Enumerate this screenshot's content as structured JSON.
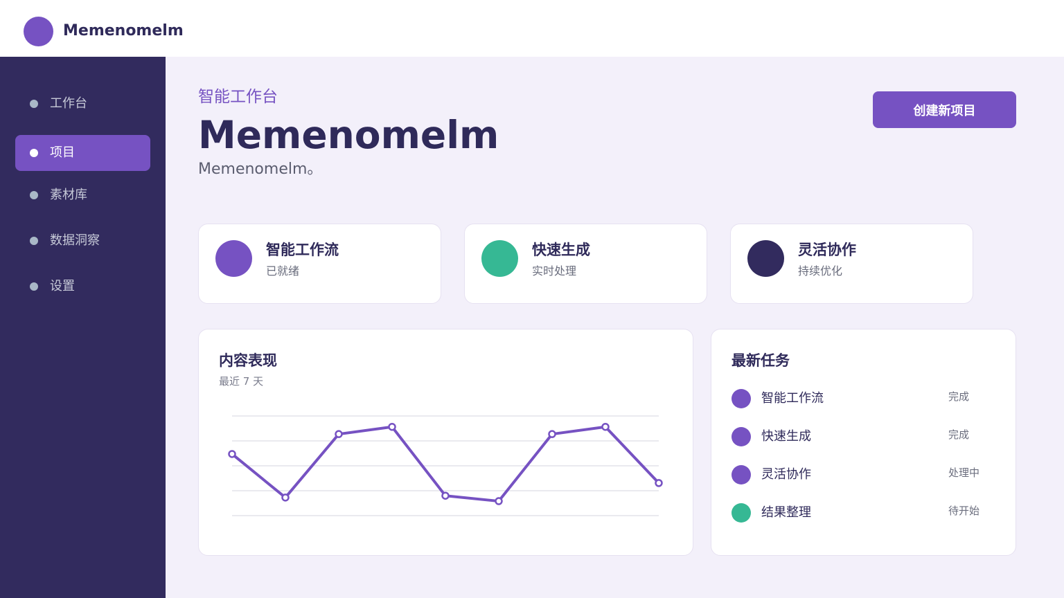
{
  "brand": {
    "name": "Memenomelm",
    "color": "#7652c2"
  },
  "sidebar": {
    "items": [
      {
        "label": "工作台",
        "active": false
      },
      {
        "label": "项目",
        "active": true
      },
      {
        "label": "素材库",
        "active": false
      },
      {
        "label": "数据洞察",
        "active": false
      },
      {
        "label": "设置",
        "active": false
      }
    ]
  },
  "header": {
    "eyebrow": "智能工作台",
    "title": "Memenomelm",
    "description": "Memenomelm。",
    "create_button": "创建新项目"
  },
  "features": [
    {
      "title": "智能工作流",
      "subtitle": "已就绪",
      "color": "#7652c2"
    },
    {
      "title": "快速生成",
      "subtitle": "实时处理",
      "color": "#36b894"
    },
    {
      "title": "灵活协作",
      "subtitle": "持续优化",
      "color": "#322b5e"
    }
  ],
  "performance": {
    "title": "内容表现",
    "subtitle": "最近 7 天",
    "line_color": "#7652c2",
    "chart_data": {
      "type": "line",
      "values": [
        64,
        40,
        75,
        79,
        41,
        38,
        75,
        79,
        48
      ],
      "ylim": [
        30,
        85
      ],
      "grid": true
    }
  },
  "tasks": {
    "title": "最新任务",
    "items": [
      {
        "label": "智能工作流",
        "status": "完成",
        "color": "#7652c2"
      },
      {
        "label": "快速生成",
        "status": "完成",
        "color": "#7652c2"
      },
      {
        "label": "灵活协作",
        "status": "处理中",
        "color": "#7652c2"
      },
      {
        "label": "结果整理",
        "status": "待开始",
        "color": "#36b894"
      }
    ]
  }
}
